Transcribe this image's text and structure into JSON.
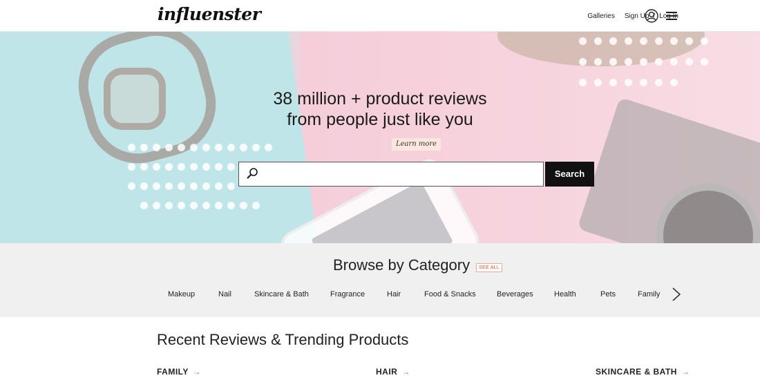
{
  "header": {
    "logo": "influenster",
    "nav": {
      "galleries": "Galleries",
      "sign_up": "Sign Up",
      "separator": "/",
      "log_in": "Log In"
    },
    "icons": [
      "user-icon",
      "hamburger-menu-icon"
    ]
  },
  "hero": {
    "title_line1": "38 million + product reviews",
    "title_line2": "from people just like you",
    "learn_more": "Learn more",
    "search": {
      "placeholder": "",
      "value": "",
      "button_label": "Search",
      "icon": "search-icon"
    }
  },
  "browse": {
    "title": "Browse by Category",
    "see_all": "SEE ALL",
    "categories": [
      "Makeup",
      "Nail",
      "Skincare & Bath",
      "Fragrance",
      "Hair",
      "Food & Snacks",
      "Beverages",
      "Health",
      "Pets",
      "Family"
    ],
    "next_icon": "chevron-right-icon"
  },
  "recent": {
    "title": "Recent Reviews & Trending Products",
    "columns": [
      "FAMILY",
      "HAIR",
      "SKINCARE & BATH"
    ],
    "arrow": "→"
  },
  "colors": {
    "accent": "#e06a4e",
    "search_button": "#111111",
    "browse_bg": "#f0f0f0"
  }
}
